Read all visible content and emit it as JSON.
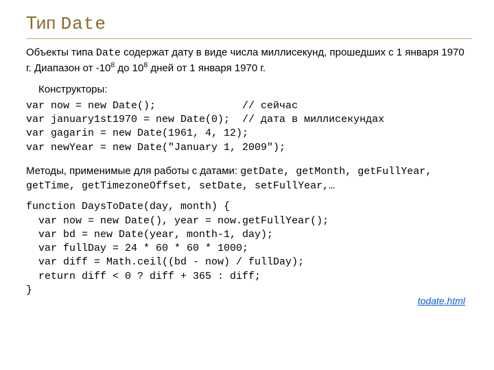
{
  "title_prefix": "Тип ",
  "title_mono": "Date",
  "intro_before": "Объекты типа ",
  "intro_type": "Date",
  "intro_after1": " содержат дату в виде числа миллисекунд, прошедших с 1 января 1970 г. Диапазон от -10",
  "intro_sup": "8",
  "intro_mid": " до 10",
  "intro_after2": " дней от 1 января 1970 г.",
  "constructors_label": "Конструкторы:",
  "code1": "var now = new Date();              // сейчас\nvar january1st1970 = new Date(0);  // дата в миллисекундах\nvar gagarin = new Date(1961, 4, 12);\nvar newYear = new Date(\"January 1, 2009\");",
  "methods_prefix": "Методы, применимые для работы с датами: ",
  "methods_list": "getDate, getMonth, getFullYear, getTime, getTimezoneOffset, setDate, setFullYear,…",
  "code2": "function DaysToDate(day, month) {\n  var now = new Date(), year = now.getFullYear();\n  var bd = new Date(year, month-1, day);\n  var fullDay = 24 * 60 * 60 * 1000;\n  var diff = Math.ceil((bd - now) / fullDay);\n  return diff < 0 ? diff + 365 : diff;\n}",
  "link_text": "todate.html"
}
